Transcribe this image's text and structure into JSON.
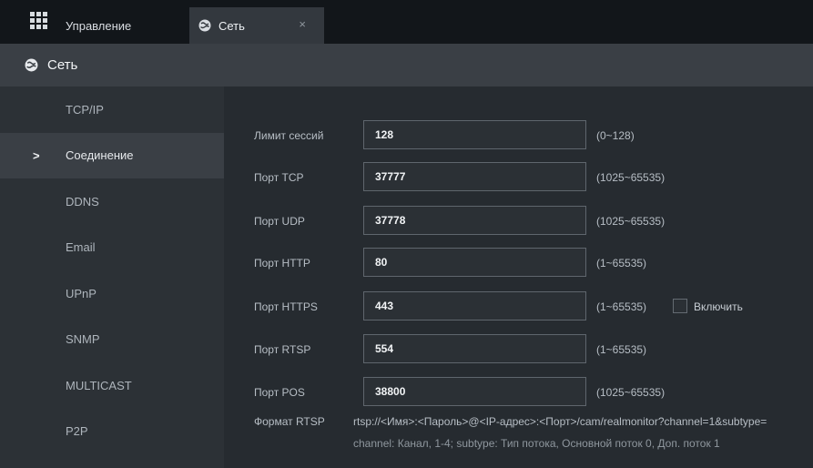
{
  "tabs": {
    "manage_label": "Управление",
    "network_label": "Сеть",
    "close_glyph": "×"
  },
  "page": {
    "title": "Сеть"
  },
  "sidebar": {
    "items": [
      {
        "label": "TCP/IP",
        "active": false
      },
      {
        "label": "Соединение",
        "active": true,
        "marker": ">"
      },
      {
        "label": "DDNS",
        "active": false
      },
      {
        "label": "Email",
        "active": false
      },
      {
        "label": "UPnP",
        "active": false
      },
      {
        "label": "SNMP",
        "active": false
      },
      {
        "label": "MULTICAST",
        "active": false
      },
      {
        "label": "P2P",
        "active": false
      }
    ]
  },
  "form": {
    "session_limit": {
      "label": "Лимит сессий",
      "value": "128",
      "range": "(0~128)"
    },
    "tcp_port": {
      "label": "Порт TCP",
      "value": "37777",
      "range": "(1025~65535)"
    },
    "udp_port": {
      "label": "Порт UDP",
      "value": "37778",
      "range": "(1025~65535)"
    },
    "http_port": {
      "label": "Порт HTTP",
      "value": "80",
      "range": "(1~65535)"
    },
    "https_port": {
      "label": "Порт HTTPS",
      "value": "443",
      "range": "(1~65535)",
      "enable_label": "Включить",
      "enabled": false
    },
    "rtsp_port": {
      "label": "Порт RTSP",
      "value": "554",
      "range": "(1~65535)"
    },
    "pos_port": {
      "label": "Порт POS",
      "value": "38800",
      "range": "(1025~65535)"
    },
    "rtsp_format": {
      "label": "Формат RTSP",
      "url": "rtsp://<Имя>:<Пароль>@<IP-адрес>:<Порт>/cam/realmonitor?channel=1&subtype=",
      "note": "channel: Канал, 1-4; subtype: Тип потока, Основной поток 0, Доп. поток 1"
    }
  },
  "icons": {
    "apps": "grid-icon",
    "network": "globe-icon"
  },
  "colors": {
    "topbar": "#12161a",
    "active_tab": "#33383e",
    "titlebar": "#3a3f45",
    "sidebar": "#2c3136",
    "content": "#262b30",
    "input_border": "#5f666d"
  }
}
